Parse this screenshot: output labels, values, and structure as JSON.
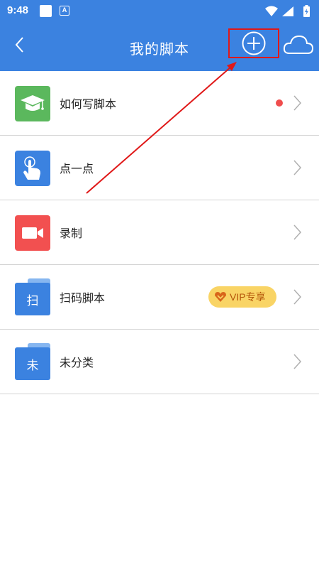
{
  "status_bar": {
    "time": "9:48",
    "notif_badge": "A"
  },
  "app_bar": {
    "title": "我的脚本",
    "back_icon": "chevron-left-icon",
    "add_icon": "plus-circle-icon",
    "cloud_icon": "cloud-icon",
    "highlight_color": "#e01818"
  },
  "list": {
    "items": [
      {
        "label": "如何写脚本",
        "icon": "graduation-cap-icon",
        "icon_color": "#5bb85d",
        "has_dot": true
      },
      {
        "label": "点一点",
        "icon": "tap-hand-icon",
        "icon_color": "#3b82e0"
      },
      {
        "label": "录制",
        "icon": "video-camera-icon",
        "icon_color": "#f25050"
      },
      {
        "label": "扫码脚本",
        "icon": "folder-icon",
        "folder_char": "扫",
        "badge": "VIP专享"
      },
      {
        "label": "未分类",
        "icon": "folder-icon",
        "folder_char": "未"
      }
    ]
  },
  "colors": {
    "primary": "#3b82e0",
    "annotation": "#e01818"
  }
}
